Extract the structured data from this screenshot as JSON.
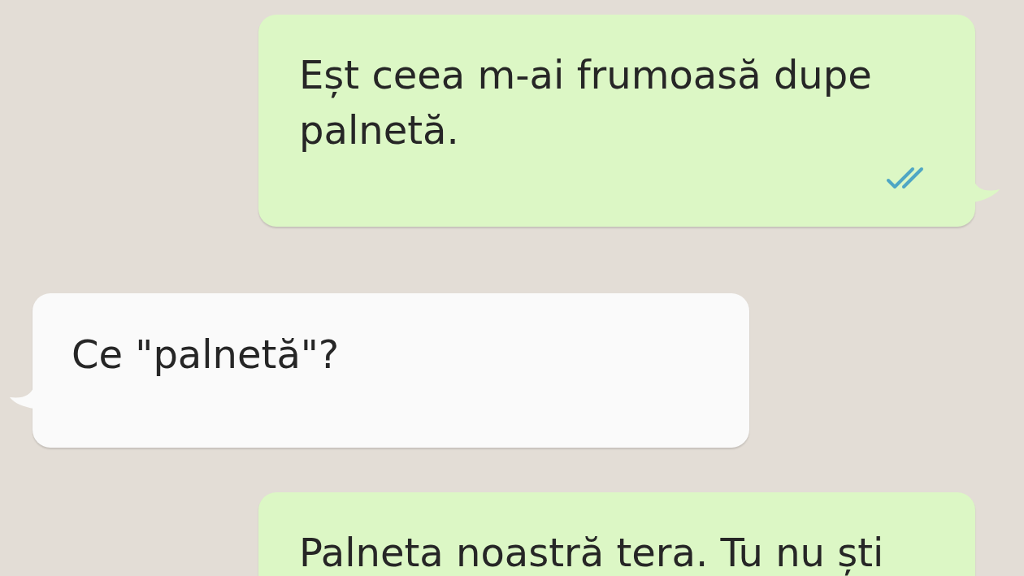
{
  "messages": [
    {
      "kind": "outgoing",
      "text": "Eșt ceea m-ai frumoasă dupe palnetă.",
      "read": true
    },
    {
      "kind": "incoming",
      "text": "Ce \"palnetă\"?"
    },
    {
      "kind": "outgoing",
      "text": "Palneta noastră tera. Tu nu ști"
    }
  ]
}
